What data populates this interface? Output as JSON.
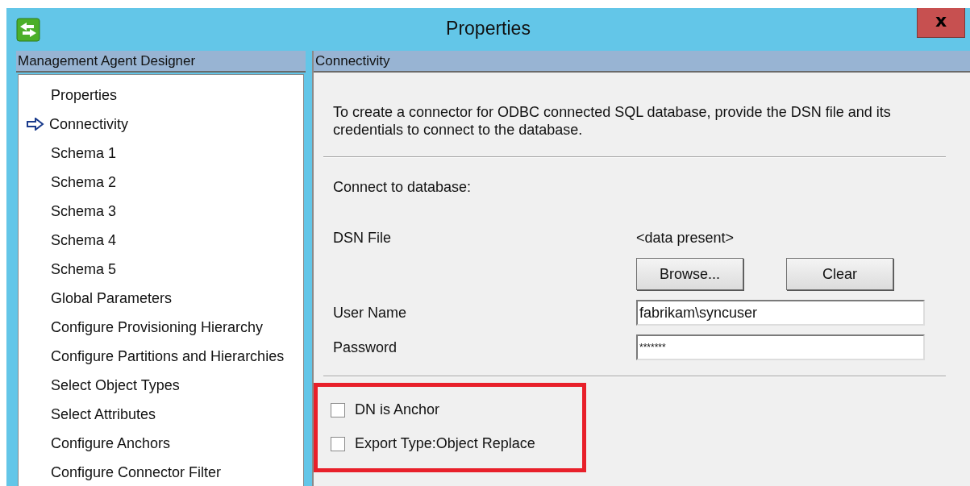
{
  "window": {
    "title": "Properties",
    "close": "x"
  },
  "sidebar": {
    "header": "Management Agent Designer",
    "items": [
      {
        "label": "Properties",
        "selected": false
      },
      {
        "label": "Connectivity",
        "selected": true
      },
      {
        "label": "Schema 1",
        "selected": false
      },
      {
        "label": "Schema 2",
        "selected": false
      },
      {
        "label": "Schema 3",
        "selected": false
      },
      {
        "label": "Schema 4",
        "selected": false
      },
      {
        "label": "Schema 5",
        "selected": false
      },
      {
        "label": "Global Parameters",
        "selected": false
      },
      {
        "label": "Configure Provisioning Hierarchy",
        "selected": false
      },
      {
        "label": "Configure Partitions and Hierarchies",
        "selected": false
      },
      {
        "label": "Select Object Types",
        "selected": false
      },
      {
        "label": "Select Attributes",
        "selected": false
      },
      {
        "label": "Configure Anchors",
        "selected": false
      },
      {
        "label": "Configure Connector Filter",
        "selected": false
      }
    ]
  },
  "panel": {
    "header": "Connectivity",
    "description": "To create a connector for ODBC connected SQL database, provide the DSN file and its credentials to connect to the database.",
    "section_label": "Connect to database:",
    "dsn": {
      "label": "DSN File",
      "value": "<data present>",
      "buttons": [
        "Browse...",
        "Clear"
      ]
    },
    "user_name": {
      "label": "User Name",
      "value": "fabrikam\\syncuser"
    },
    "password": {
      "label": "Password",
      "value": "*******"
    },
    "checkboxes": [
      {
        "label": "DN is Anchor",
        "checked": false
      },
      {
        "label": "Export Type:Object Replace",
        "checked": false
      }
    ]
  }
}
